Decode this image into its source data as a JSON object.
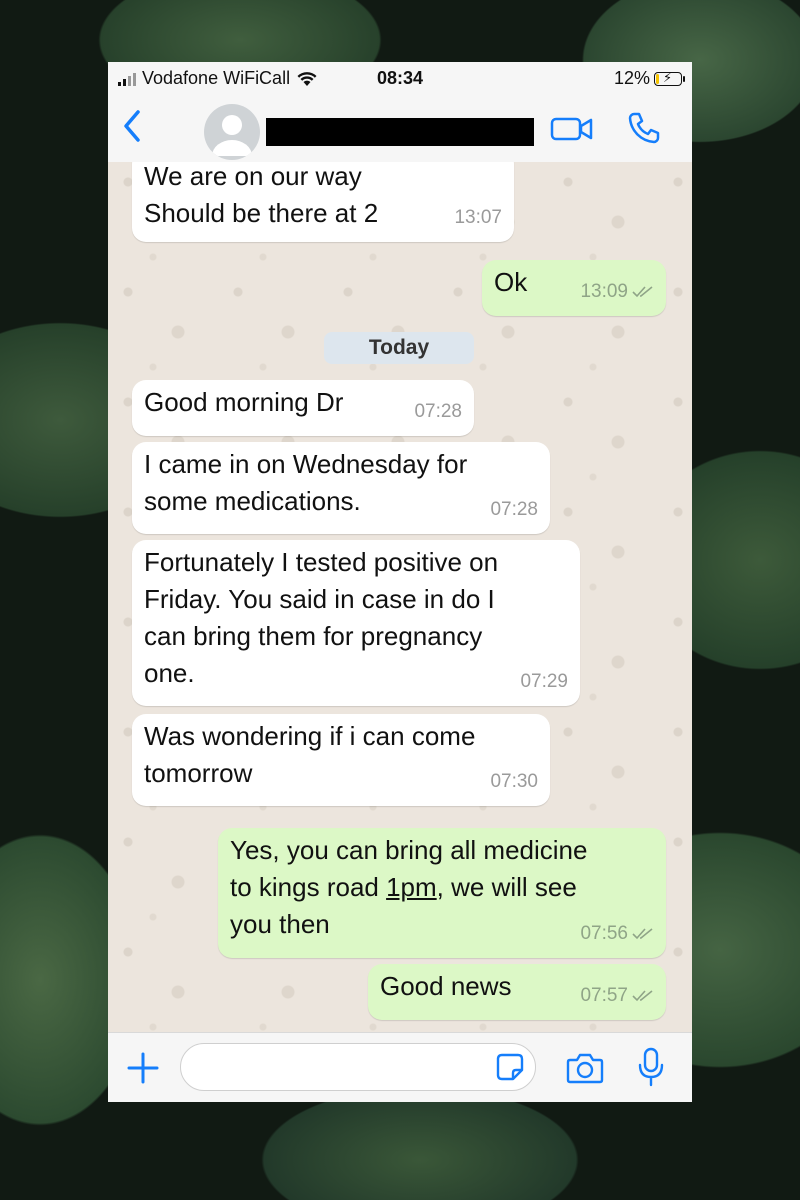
{
  "status_bar": {
    "carrier": "Vodafone WiFiCall",
    "time": "08:34",
    "battery": "12%",
    "battery_level": 0.12
  },
  "header": {
    "back_icon": "chevron-left-icon",
    "avatar_icon": "person-icon",
    "video_icon": "video-camera-icon",
    "call_icon": "phone-icon"
  },
  "chat": {
    "date_separator": "Today",
    "messages": [
      {
        "direction": "incoming",
        "text": "We are on our way\nShould be there at 2",
        "time": "13:07"
      },
      {
        "direction": "outgoing",
        "text": "Ok",
        "time": "13:09",
        "read": true
      },
      {
        "direction": "incoming",
        "text": "Good morning Dr",
        "time": "07:28"
      },
      {
        "direction": "incoming",
        "text": "I came in on Wednesday for\nsome medications.",
        "time": "07:28"
      },
      {
        "direction": "incoming",
        "text": "Fortunately I tested positive on\nFriday. You said in case in do I\ncan bring them for pregnancy\none.",
        "time": "07:29"
      },
      {
        "direction": "incoming",
        "text": "Was wondering if i can come\ntomorrow",
        "time": "07:30"
      },
      {
        "direction": "outgoing",
        "text_before": "Yes,  you can bring all medicine\nto kings road ",
        "text_link": "1pm",
        "text_after": ", we will see\nyou then",
        "time": "07:56",
        "read": true
      },
      {
        "direction": "outgoing",
        "text": "Good news",
        "time": "07:57",
        "read": true
      }
    ]
  },
  "input_bar": {
    "placeholder": "",
    "plus_icon": "plus-icon",
    "sticker_icon": "sticker-icon",
    "camera_icon": "camera-icon",
    "mic_icon": "microphone-icon"
  },
  "colors": {
    "accent": "#157EFB",
    "incoming_bubble": "#FFFFFF",
    "outgoing_bubble": "#DCF8C6",
    "chat_background": "#ECE5DD",
    "battery_fill": "#F5C400"
  }
}
